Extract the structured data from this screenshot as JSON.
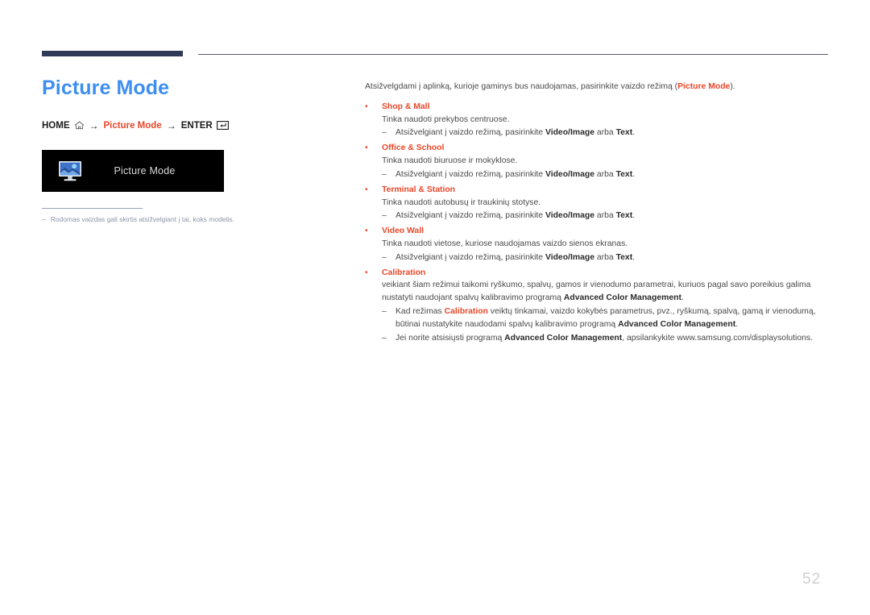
{
  "page": {
    "number": "52",
    "title": "Picture Mode"
  },
  "breadcrumb": {
    "home_label": "HOME",
    "home_icon": "home-icon",
    "arrow1": "→",
    "middle_label": "Picture Mode",
    "arrow2": "→",
    "enter_label": "ENTER",
    "enter_icon": "enter-key-icon"
  },
  "menu_box": {
    "icon": "picture-mode-monitor-icon",
    "label": "Picture Mode"
  },
  "note": {
    "dash": "–",
    "text": "Rodomas vaizdas gali skirtis atsižvelgiant į tai, koks modelis."
  },
  "content": {
    "intro_before": "Atsižvelgdami į aplinką, kurioje gaminys bus naudojamas, pasirinkite vaizdo režimą (",
    "intro_highlight": "Picture Mode",
    "intro_after": ").",
    "bullet_marker": "•",
    "sub_marker": "–",
    "items": [
      {
        "title": "Shop & Mall",
        "desc": "Tinka naudoti prekybos centruose.",
        "sub": [
          {
            "before": "Atsižvelgiant į vaizdo režimą, pasirinkite ",
            "b1": "Video/Image",
            "mid": " arba ",
            "b2": "Text",
            "after": "."
          }
        ]
      },
      {
        "title": "Office & School",
        "desc": "Tinka naudoti biuruose ir mokyklose.",
        "sub": [
          {
            "before": "Atsižvelgiant į vaizdo režimą, pasirinkite ",
            "b1": "Video/Image",
            "mid": " arba ",
            "b2": "Text",
            "after": "."
          }
        ]
      },
      {
        "title": "Terminal & Station",
        "desc": "Tinka naudoti autobusų ir traukinių stotyse.",
        "sub": [
          {
            "before": "Atsižvelgiant į vaizdo režimą, pasirinkite ",
            "b1": "Video/Image",
            "mid": " arba ",
            "b2": "Text",
            "after": "."
          }
        ]
      },
      {
        "title": "Video Wall",
        "desc": "Tinka naudoti vietose, kuriose naudojamas vaizdo sienos ekranas.",
        "sub": [
          {
            "before": "Atsižvelgiant į vaizdo režimą, pasirinkite ",
            "b1": "Video/Image",
            "mid": " arba ",
            "b2": "Text",
            "after": "."
          }
        ]
      }
    ],
    "calibration": {
      "title": "Calibration",
      "desc_before": "veikiant šiam režimui taikomi ryškumo, spalvų, gamos ir vienodumo parametrai, kuriuos pagal savo poreikius galima nustatyti naudojant spalvų kalibravimo programą ",
      "desc_bold": "Advanced Color Management",
      "desc_after": ".",
      "sub1_before": "Kad režimas ",
      "sub1_red": "Calibration",
      "sub1_mid": " veiktų tinkamai, vaizdo kokybės parametrus, pvz., ryškumą, spalvą, gamą ir vienodumą, būtinai nustatykite naudodami spalvų kalibravimo programą ",
      "sub1_bold": "Advanced Color Management",
      "sub1_after": ".",
      "sub2_before": "Jei norite atsisiųsti programą ",
      "sub2_bold": "Advanced Color Management",
      "sub2_after": ", apsilankykite www.samsung.com/displaysolutions."
    }
  },
  "colors": {
    "title_blue": "#3d8ef0",
    "accent_red": "#e8472a",
    "rule_navy": "#2e3a57",
    "body_gray": "#4a4a4a",
    "note_gray": "#8e93a8",
    "page_number_gray": "#cfcfcf"
  }
}
